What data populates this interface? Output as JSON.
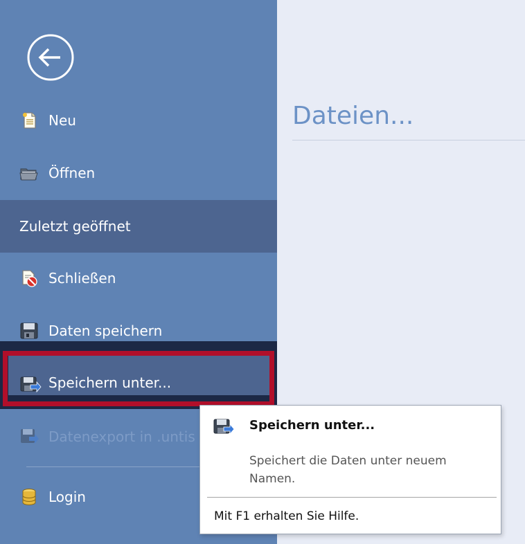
{
  "panel": {
    "title": "Dateien..."
  },
  "menu": {
    "neu": "Neu",
    "oeffnen": "Öffnen",
    "zuletzt": "Zuletzt geöffnet",
    "schliessen": "Schließen",
    "speichern": "Daten speichern",
    "speichern_unter": "Speichern unter...",
    "export": "Datenexport in .untis",
    "login": "Login"
  },
  "tooltip": {
    "title": "Speichern unter...",
    "description": "Speichert die Daten unter neuem Namen.",
    "help": "Mit F1 erhalten Sie Hilfe."
  },
  "colors": {
    "sidebar": "#5f83b4",
    "selected": "#4d6590",
    "highlight": "#b10f2a",
    "title": "#6c92c6"
  }
}
